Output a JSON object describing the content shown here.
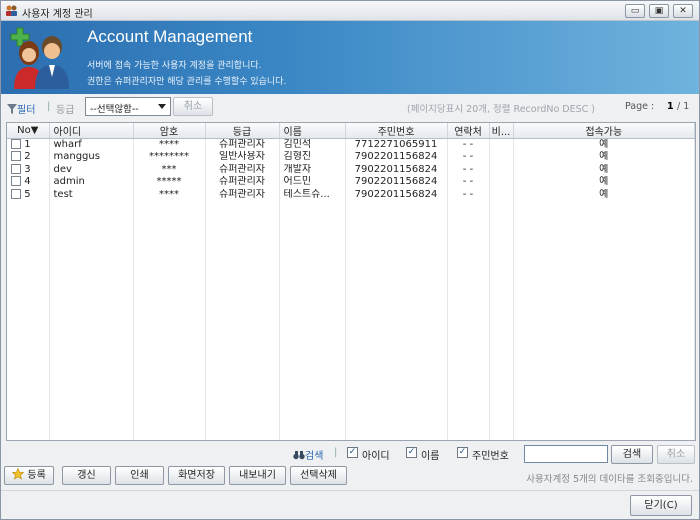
{
  "window": {
    "title": "사용자 계정 관리",
    "controls": [
      "▭",
      "▣",
      "✕"
    ]
  },
  "header": {
    "title": "Account Management",
    "line1": "서버에 접속 가능한 사용자 계정을 관리합니다.",
    "line2": "권한은 슈퍼관리자만 해당 관리를 수행할수 있습니다."
  },
  "toolbar": {
    "filter_label": "필터",
    "grade_label": "등급",
    "select_value": "--선택않함--",
    "cancel_label": "취소",
    "paging_info": "(페이지당표시 20개, 정렬 RecordNo DESC )",
    "page_label": "Page :",
    "page_current": "1",
    "page_total": "/ 1"
  },
  "table": {
    "columns": [
      "No▼",
      "아이디",
      "암호",
      "등급",
      "이름",
      "주민번호",
      "연락처",
      "비...",
      "접속가능"
    ],
    "rows": [
      {
        "no": "1",
        "id": "wharf",
        "pw": "****",
        "grade": "슈퍼관리자",
        "name": "김민석",
        "ssn": "7712271065911",
        "contact": "-  -",
        "note": "",
        "access": "예"
      },
      {
        "no": "2",
        "id": "manggus",
        "pw": "********",
        "grade": "일반사용자",
        "name": "김형진",
        "ssn": "7902201156824",
        "contact": "-  -",
        "note": "",
        "access": "예"
      },
      {
        "no": "3",
        "id": "dev",
        "pw": "***",
        "grade": "슈퍼관리자",
        "name": "개발자",
        "ssn": "7902201156824",
        "contact": "-  -",
        "note": "",
        "access": "예"
      },
      {
        "no": "4",
        "id": "admin",
        "pw": "*****",
        "grade": "슈퍼관리자",
        "name": "어드민",
        "ssn": "7902201156824",
        "contact": "-  -",
        "note": "",
        "access": "예"
      },
      {
        "no": "5",
        "id": "test",
        "pw": "****",
        "grade": "슈퍼관리자",
        "name": "테스트슈...",
        "ssn": "7902201156824",
        "contact": "-  -",
        "note": "",
        "access": "예"
      }
    ]
  },
  "search": {
    "label": "검색",
    "opt_id": "아이디",
    "opt_name": "이름",
    "opt_ssn": "주민번호",
    "input_value": "",
    "search_button": "검색",
    "cancel_button": "취소"
  },
  "actions": {
    "register": "등록",
    "refresh": "갱신",
    "print": "인쇄",
    "save_screen": "화면저장",
    "export": "내보내기",
    "delete_selected": "선택삭제",
    "status": "사용자계정 5개의 데이타를 조회중입니다.",
    "close": "닫기(C)"
  },
  "colors": {
    "header_start": "#2c6fb0",
    "header_end": "#6fb3de",
    "link": "#2a66b5"
  }
}
